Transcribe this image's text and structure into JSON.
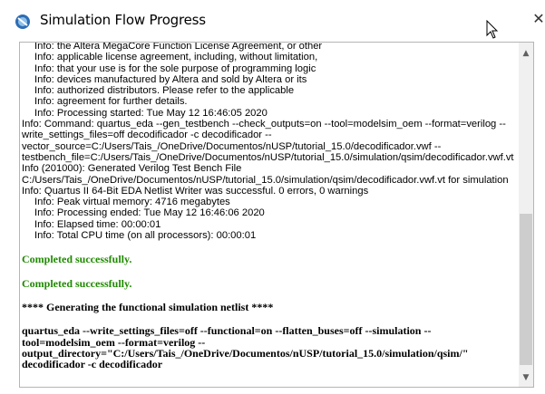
{
  "window": {
    "title": "Simulation Flow Progress",
    "close_symbol": "✕"
  },
  "log": {
    "lines": [
      {
        "text": "Info: the Altera MegaCore Function License Agreement, or other",
        "style": "indent"
      },
      {
        "text": "Info: applicable license agreement, including, without limitation,",
        "style": "indent"
      },
      {
        "text": "Info: that your use is for the sole purpose of programming logic",
        "style": "indent"
      },
      {
        "text": "Info: devices manufactured by Altera and sold by Altera or its",
        "style": "indent"
      },
      {
        "text": "Info: authorized distributors.  Please refer to the applicable",
        "style": "indent"
      },
      {
        "text": "Info: agreement for further details.",
        "style": "indent"
      },
      {
        "text": "Info: Processing started: Tue May 12 16:46:05 2020",
        "style": "indent"
      },
      {
        "text": "Info: Command: quartus_eda --gen_testbench --check_outputs=on --tool=modelsim_oem --format=verilog --",
        "style": "normal"
      },
      {
        "text": "write_settings_files=off decodificador -c decodificador --",
        "style": "normal"
      },
      {
        "text": "vector_source=C:/Users/Tais_/OneDrive/Documentos/nUSP/tutorial_15.0/decodificador.vwf --",
        "style": "normal"
      },
      {
        "text": "testbench_file=C:/Users/Tais_/OneDrive/Documentos/nUSP/tutorial_15.0/simulation/qsim/decodificador.vwf.vt",
        "style": "normal"
      },
      {
        "text": "Info (201000): Generated Verilog Test Bench File",
        "style": "normal"
      },
      {
        "text": "C:/Users/Tais_/OneDrive/Documentos/nUSP/tutorial_15.0/simulation/qsim/decodificador.vwf.vt for simulation",
        "style": "normal"
      },
      {
        "text": "Info: Quartus II 64-Bit EDA Netlist Writer was successful. 0 errors, 0 warnings",
        "style": "normal"
      },
      {
        "text": "Info: Peak virtual memory: 4716 megabytes",
        "style": "indent"
      },
      {
        "text": "Info: Processing ended: Tue May 12 16:46:06 2020",
        "style": "indent"
      },
      {
        "text": "Info: Elapsed time: 00:00:01",
        "style": "indent"
      },
      {
        "text": "Info: Total CPU time (on all processors): 00:00:01",
        "style": "indent"
      },
      {
        "text": "",
        "style": "gap"
      },
      {
        "text": "Completed successfully.",
        "style": "success"
      },
      {
        "text": "",
        "style": "gap"
      },
      {
        "text": "Completed successfully.",
        "style": "success"
      },
      {
        "text": "",
        "style": "gap"
      },
      {
        "text": "**** Generating the functional simulation netlist ****",
        "style": "bold"
      },
      {
        "text": "",
        "style": "gap"
      },
      {
        "text": "quartus_eda --write_settings_files=off --functional=on --flatten_buses=off --simulation --",
        "style": "bold"
      },
      {
        "text": "tool=modelsim_oem --format=verilog --",
        "style": "bold"
      },
      {
        "text": "output_directory=\"C:/Users/Tais_/OneDrive/Documentos/nUSP/tutorial_15.0/simulation/qsim/\"",
        "style": "bold"
      },
      {
        "text": "decodificador -c decodificador",
        "style": "bold"
      }
    ]
  },
  "scrollbar": {
    "up_symbol": "▲",
    "down_symbol": "▼",
    "scroll_position": 0.5
  },
  "colors": {
    "success": "#1f8a00",
    "scrollbar_track": "#f0f0f0",
    "scrollbar_thumb": "#cdcdcd"
  }
}
